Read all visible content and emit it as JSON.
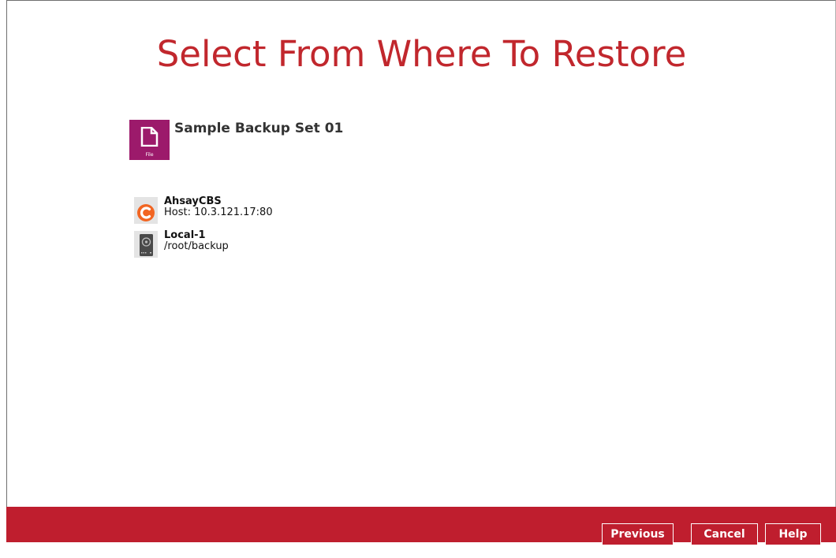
{
  "title": "Select From Where To Restore",
  "backup_set": {
    "name": "Sample Backup Set 01",
    "icon": "file-icon",
    "icon_caption": "File"
  },
  "destinations": [
    {
      "name": "AhsayCBS",
      "detail": "Host: 10.3.121.17:80",
      "icon": "ahsay-logo-icon"
    },
    {
      "name": "Local-1",
      "detail": "/root/backup",
      "icon": "hard-drive-icon"
    }
  ],
  "buttons": {
    "previous": "Previous",
    "cancel": "Cancel",
    "help": "Help"
  },
  "colors": {
    "accent": "#bf1e2e",
    "title": "#c1272d",
    "backup_set_tile": "#9c1a6b",
    "ahsay_orange": "#f26522"
  }
}
